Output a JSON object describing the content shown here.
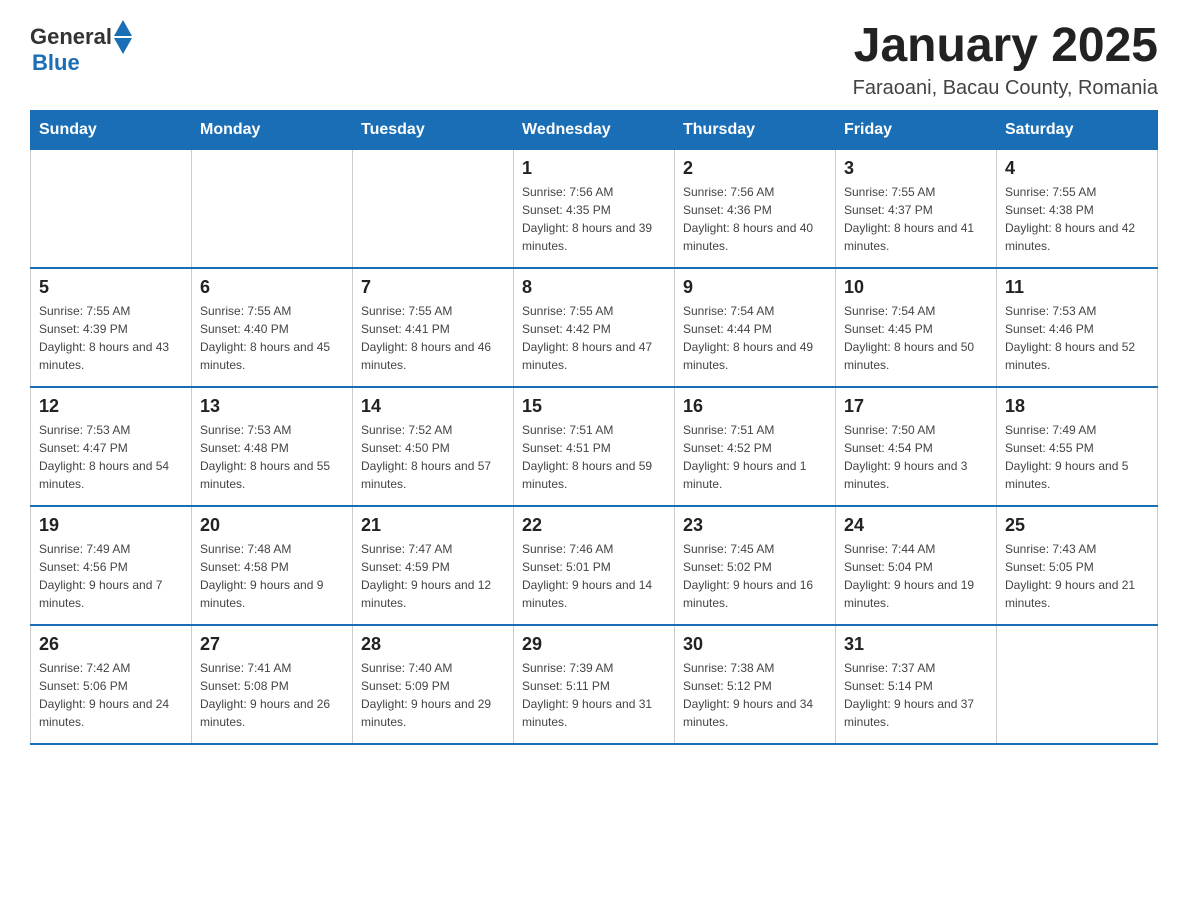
{
  "logo": {
    "text_general": "General",
    "text_blue": "Blue"
  },
  "calendar": {
    "title": "January 2025",
    "subtitle": "Faraoani, Bacau County, Romania",
    "days_of_week": [
      "Sunday",
      "Monday",
      "Tuesday",
      "Wednesday",
      "Thursday",
      "Friday",
      "Saturday"
    ],
    "weeks": [
      [
        {
          "day": "",
          "info": ""
        },
        {
          "day": "",
          "info": ""
        },
        {
          "day": "",
          "info": ""
        },
        {
          "day": "1",
          "info": "Sunrise: 7:56 AM\nSunset: 4:35 PM\nDaylight: 8 hours and 39 minutes."
        },
        {
          "day": "2",
          "info": "Sunrise: 7:56 AM\nSunset: 4:36 PM\nDaylight: 8 hours and 40 minutes."
        },
        {
          "day": "3",
          "info": "Sunrise: 7:55 AM\nSunset: 4:37 PM\nDaylight: 8 hours and 41 minutes."
        },
        {
          "day": "4",
          "info": "Sunrise: 7:55 AM\nSunset: 4:38 PM\nDaylight: 8 hours and 42 minutes."
        }
      ],
      [
        {
          "day": "5",
          "info": "Sunrise: 7:55 AM\nSunset: 4:39 PM\nDaylight: 8 hours and 43 minutes."
        },
        {
          "day": "6",
          "info": "Sunrise: 7:55 AM\nSunset: 4:40 PM\nDaylight: 8 hours and 45 minutes."
        },
        {
          "day": "7",
          "info": "Sunrise: 7:55 AM\nSunset: 4:41 PM\nDaylight: 8 hours and 46 minutes."
        },
        {
          "day": "8",
          "info": "Sunrise: 7:55 AM\nSunset: 4:42 PM\nDaylight: 8 hours and 47 minutes."
        },
        {
          "day": "9",
          "info": "Sunrise: 7:54 AM\nSunset: 4:44 PM\nDaylight: 8 hours and 49 minutes."
        },
        {
          "day": "10",
          "info": "Sunrise: 7:54 AM\nSunset: 4:45 PM\nDaylight: 8 hours and 50 minutes."
        },
        {
          "day": "11",
          "info": "Sunrise: 7:53 AM\nSunset: 4:46 PM\nDaylight: 8 hours and 52 minutes."
        }
      ],
      [
        {
          "day": "12",
          "info": "Sunrise: 7:53 AM\nSunset: 4:47 PM\nDaylight: 8 hours and 54 minutes."
        },
        {
          "day": "13",
          "info": "Sunrise: 7:53 AM\nSunset: 4:48 PM\nDaylight: 8 hours and 55 minutes."
        },
        {
          "day": "14",
          "info": "Sunrise: 7:52 AM\nSunset: 4:50 PM\nDaylight: 8 hours and 57 minutes."
        },
        {
          "day": "15",
          "info": "Sunrise: 7:51 AM\nSunset: 4:51 PM\nDaylight: 8 hours and 59 minutes."
        },
        {
          "day": "16",
          "info": "Sunrise: 7:51 AM\nSunset: 4:52 PM\nDaylight: 9 hours and 1 minute."
        },
        {
          "day": "17",
          "info": "Sunrise: 7:50 AM\nSunset: 4:54 PM\nDaylight: 9 hours and 3 minutes."
        },
        {
          "day": "18",
          "info": "Sunrise: 7:49 AM\nSunset: 4:55 PM\nDaylight: 9 hours and 5 minutes."
        }
      ],
      [
        {
          "day": "19",
          "info": "Sunrise: 7:49 AM\nSunset: 4:56 PM\nDaylight: 9 hours and 7 minutes."
        },
        {
          "day": "20",
          "info": "Sunrise: 7:48 AM\nSunset: 4:58 PM\nDaylight: 9 hours and 9 minutes."
        },
        {
          "day": "21",
          "info": "Sunrise: 7:47 AM\nSunset: 4:59 PM\nDaylight: 9 hours and 12 minutes."
        },
        {
          "day": "22",
          "info": "Sunrise: 7:46 AM\nSunset: 5:01 PM\nDaylight: 9 hours and 14 minutes."
        },
        {
          "day": "23",
          "info": "Sunrise: 7:45 AM\nSunset: 5:02 PM\nDaylight: 9 hours and 16 minutes."
        },
        {
          "day": "24",
          "info": "Sunrise: 7:44 AM\nSunset: 5:04 PM\nDaylight: 9 hours and 19 minutes."
        },
        {
          "day": "25",
          "info": "Sunrise: 7:43 AM\nSunset: 5:05 PM\nDaylight: 9 hours and 21 minutes."
        }
      ],
      [
        {
          "day": "26",
          "info": "Sunrise: 7:42 AM\nSunset: 5:06 PM\nDaylight: 9 hours and 24 minutes."
        },
        {
          "day": "27",
          "info": "Sunrise: 7:41 AM\nSunset: 5:08 PM\nDaylight: 9 hours and 26 minutes."
        },
        {
          "day": "28",
          "info": "Sunrise: 7:40 AM\nSunset: 5:09 PM\nDaylight: 9 hours and 29 minutes."
        },
        {
          "day": "29",
          "info": "Sunrise: 7:39 AM\nSunset: 5:11 PM\nDaylight: 9 hours and 31 minutes."
        },
        {
          "day": "30",
          "info": "Sunrise: 7:38 AM\nSunset: 5:12 PM\nDaylight: 9 hours and 34 minutes."
        },
        {
          "day": "31",
          "info": "Sunrise: 7:37 AM\nSunset: 5:14 PM\nDaylight: 9 hours and 37 minutes."
        },
        {
          "day": "",
          "info": ""
        }
      ]
    ]
  }
}
